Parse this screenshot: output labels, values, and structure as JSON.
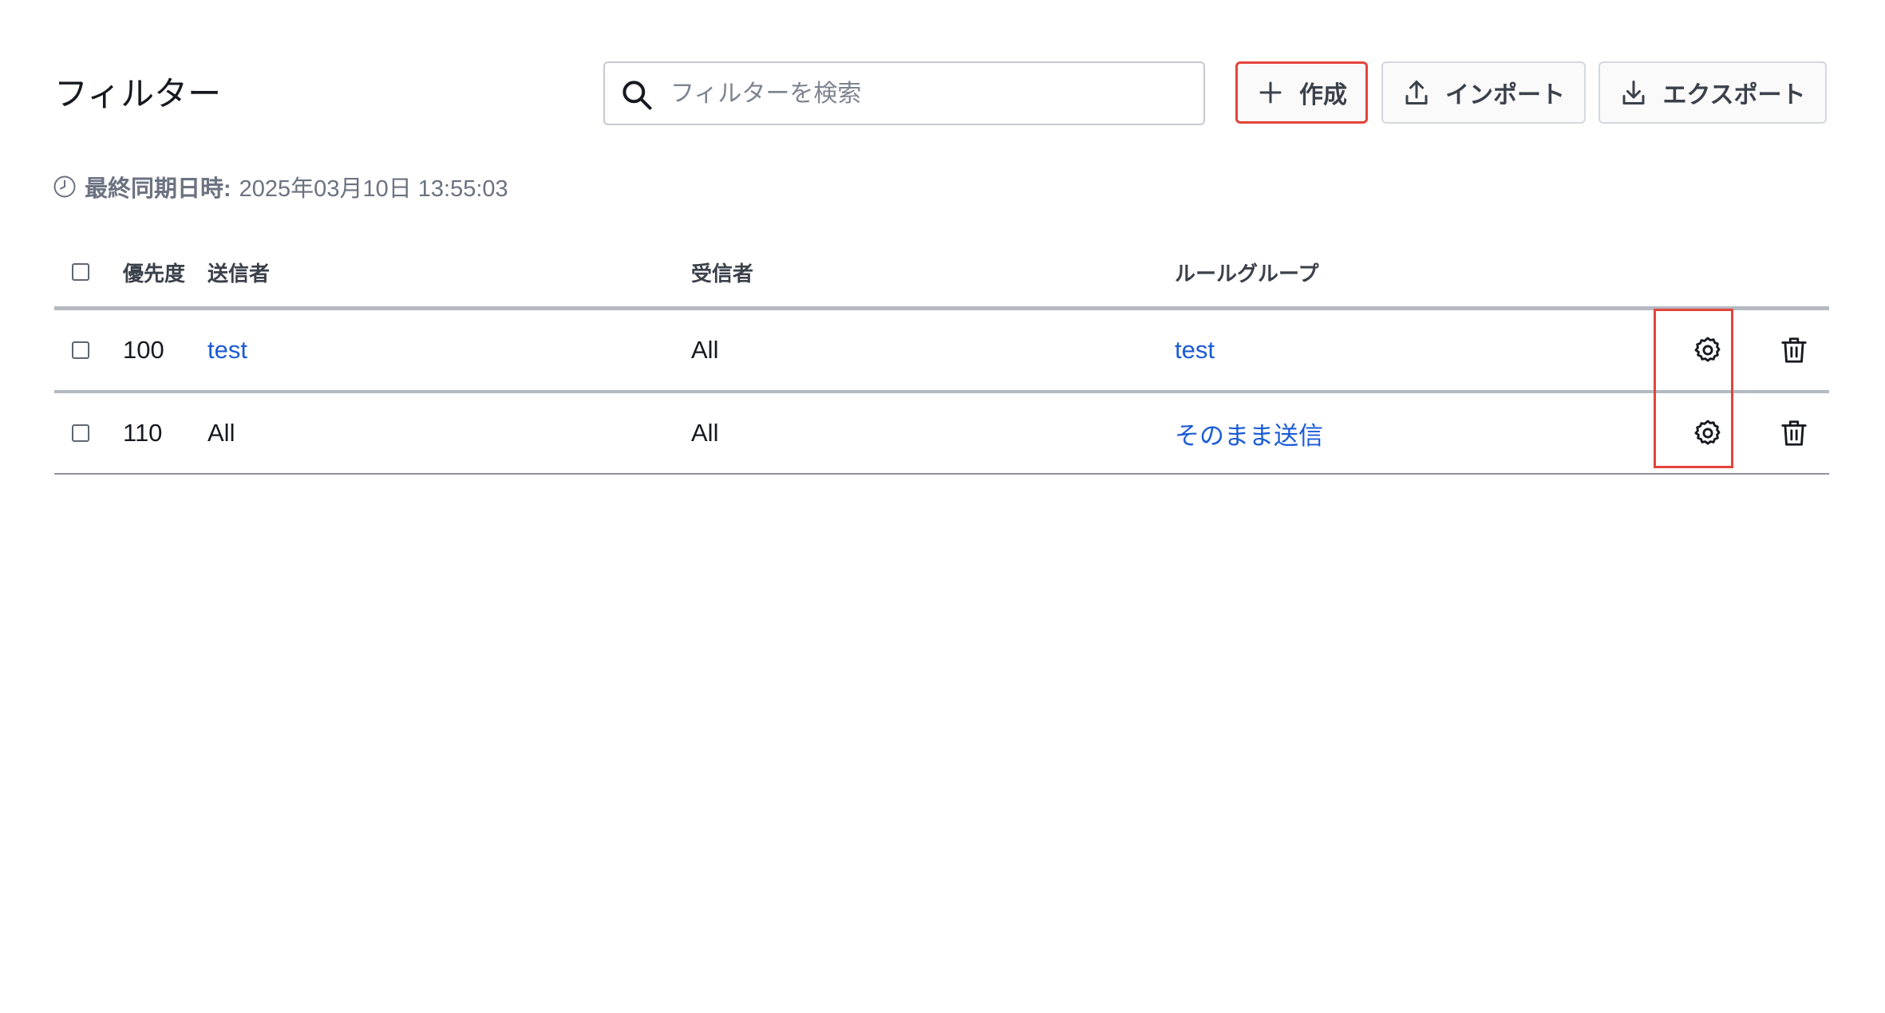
{
  "page": {
    "title": "フィルター"
  },
  "search": {
    "placeholder": "フィルターを検索",
    "value": ""
  },
  "toolbar": {
    "create_label": "作成",
    "import_label": "インポート",
    "export_label": "エクスポート"
  },
  "sync": {
    "label": "最終同期日時:",
    "value": "2025年03月10日 13:55:03"
  },
  "table": {
    "headers": {
      "priority": "優先度",
      "sender": "送信者",
      "recipient": "受信者",
      "rule_group": "ルールグループ"
    },
    "rows": [
      {
        "priority": "100",
        "sender": "test",
        "recipient": "All",
        "rule_group": "test"
      },
      {
        "priority": "110",
        "sender": "All",
        "recipient": "All",
        "rule_group": "そのまま送信"
      }
    ]
  },
  "colors": {
    "link": "#1a5bd6",
    "highlight": "#e3443a"
  },
  "icons": [
    "search-icon",
    "plus-icon",
    "upload-icon",
    "download-icon",
    "clock-icon",
    "gear-icon",
    "trash-icon"
  ]
}
